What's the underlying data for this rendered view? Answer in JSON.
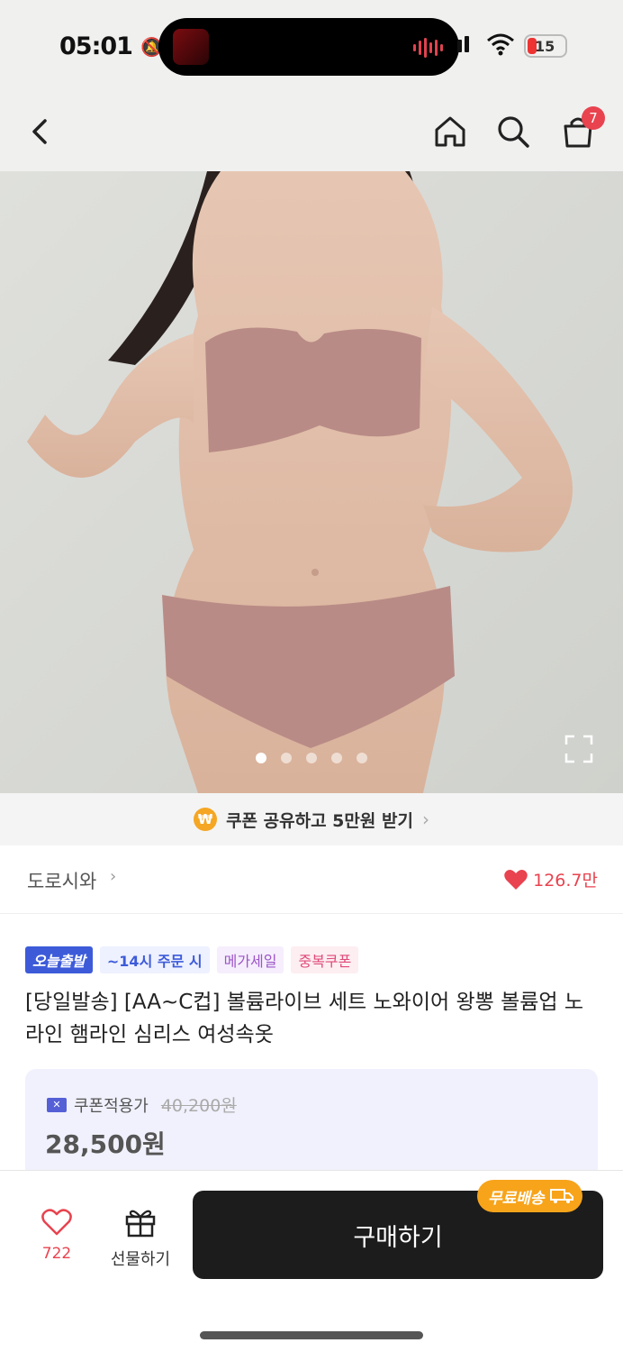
{
  "status_bar": {
    "time": "05:01",
    "battery": "15"
  },
  "nav": {
    "cart_count": "7"
  },
  "hero": {
    "image_count": 5,
    "active_index": 0
  },
  "coupon_banner": {
    "icon": "₩",
    "text": "쿠폰 공유하고 5만원 받기"
  },
  "brand": {
    "name": "도로시와",
    "likes": "126.7만"
  },
  "tags": [
    "오늘출발",
    "~14시 주문 시",
    "메가세일",
    "중복쿠폰"
  ],
  "product": {
    "title": "[당일발송] [AA~C컵] 볼륨라이브 세트 노와이어 왕뽕 볼륨업 노라인 햄라인 심리스 여성속옷"
  },
  "price": {
    "label": "쿠폰적용가",
    "original": "40,200원",
    "sale": "28,500원"
  },
  "bottom_bar": {
    "wish_count": "722",
    "gift_label": "선물하기",
    "buy_label": "구매하기",
    "free_shipping_label": "무료배송"
  },
  "colors": {
    "accent_red": "#e8434f",
    "tag_blue": "#3d5bd9",
    "free_ship_orange": "#f7a41b",
    "buy_button": "#1c1c1c"
  }
}
